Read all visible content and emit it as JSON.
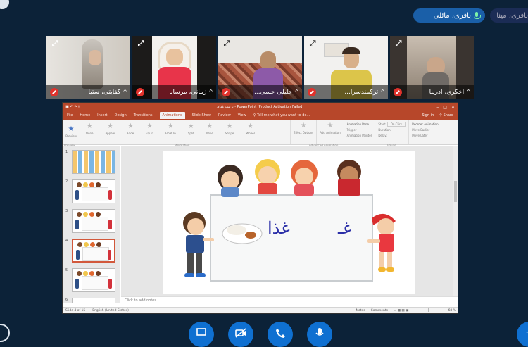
{
  "participants_speaking": {
    "active": {
      "name": "باقری، مائلی"
    },
    "other": {
      "name": "باقری، مینا"
    }
  },
  "video_tiles": [
    {
      "name": "کفایتی، ستیا"
    },
    {
      "name": "زمانی، مرسانا"
    },
    {
      "name": "جلیلی حسی..."
    },
    {
      "name": "ترکمندسرا..."
    },
    {
      "name": "اخگری، آدرینا"
    }
  ],
  "powerpoint": {
    "window_title": "PowerPoint (Product Activation Failed)",
    "file_name": "ترتیب غذای",
    "tabs": [
      "File",
      "Home",
      "Insert",
      "Design",
      "Transitions",
      "Animations",
      "Slide Show",
      "Review",
      "View"
    ],
    "active_tab": "Animations",
    "tell_me": "Tell me what you want to do...",
    "sign_in": "Sign in",
    "share": "Share",
    "ribbon": {
      "preview_label": "Preview",
      "animations": [
        "None",
        "Appear",
        "Fade",
        "Fly In",
        "Float In",
        "Split",
        "Wipe",
        "Shape",
        "Wheel",
        "Random Bars"
      ],
      "effect_options": "Effect Options",
      "add_animation": "Add Animation",
      "animation_pane": "Animation Pane",
      "trigger": "Trigger",
      "animation_painter": "Animation Painter",
      "start_label": "Start:",
      "start_value": "On Click",
      "duration_label": "Duration:",
      "delay_label": "Delay:",
      "reorder_label": "Reorder Animation",
      "move_earlier": "Move Earlier",
      "move_later": "Move Later",
      "group_preview": "Preview",
      "group_animation": "Animation",
      "group_advanced": "Advanced Animation",
      "group_timing": "Timing"
    },
    "slides": [
      "1",
      "2",
      "3",
      "4",
      "5",
      "6"
    ],
    "selected_slide": "4",
    "slide_text_right": "غـ",
    "slide_text_left": "غذا",
    "notes_placeholder": "Click to add notes",
    "status_slide": "Slide 4 of 15",
    "status_language": "English (United States)",
    "status_notes": "Notes",
    "status_comments": "Comments",
    "zoom": "68 %"
  },
  "controls": {
    "colors": {
      "primary": "#0f70d1",
      "background": "#0c2238"
    }
  }
}
